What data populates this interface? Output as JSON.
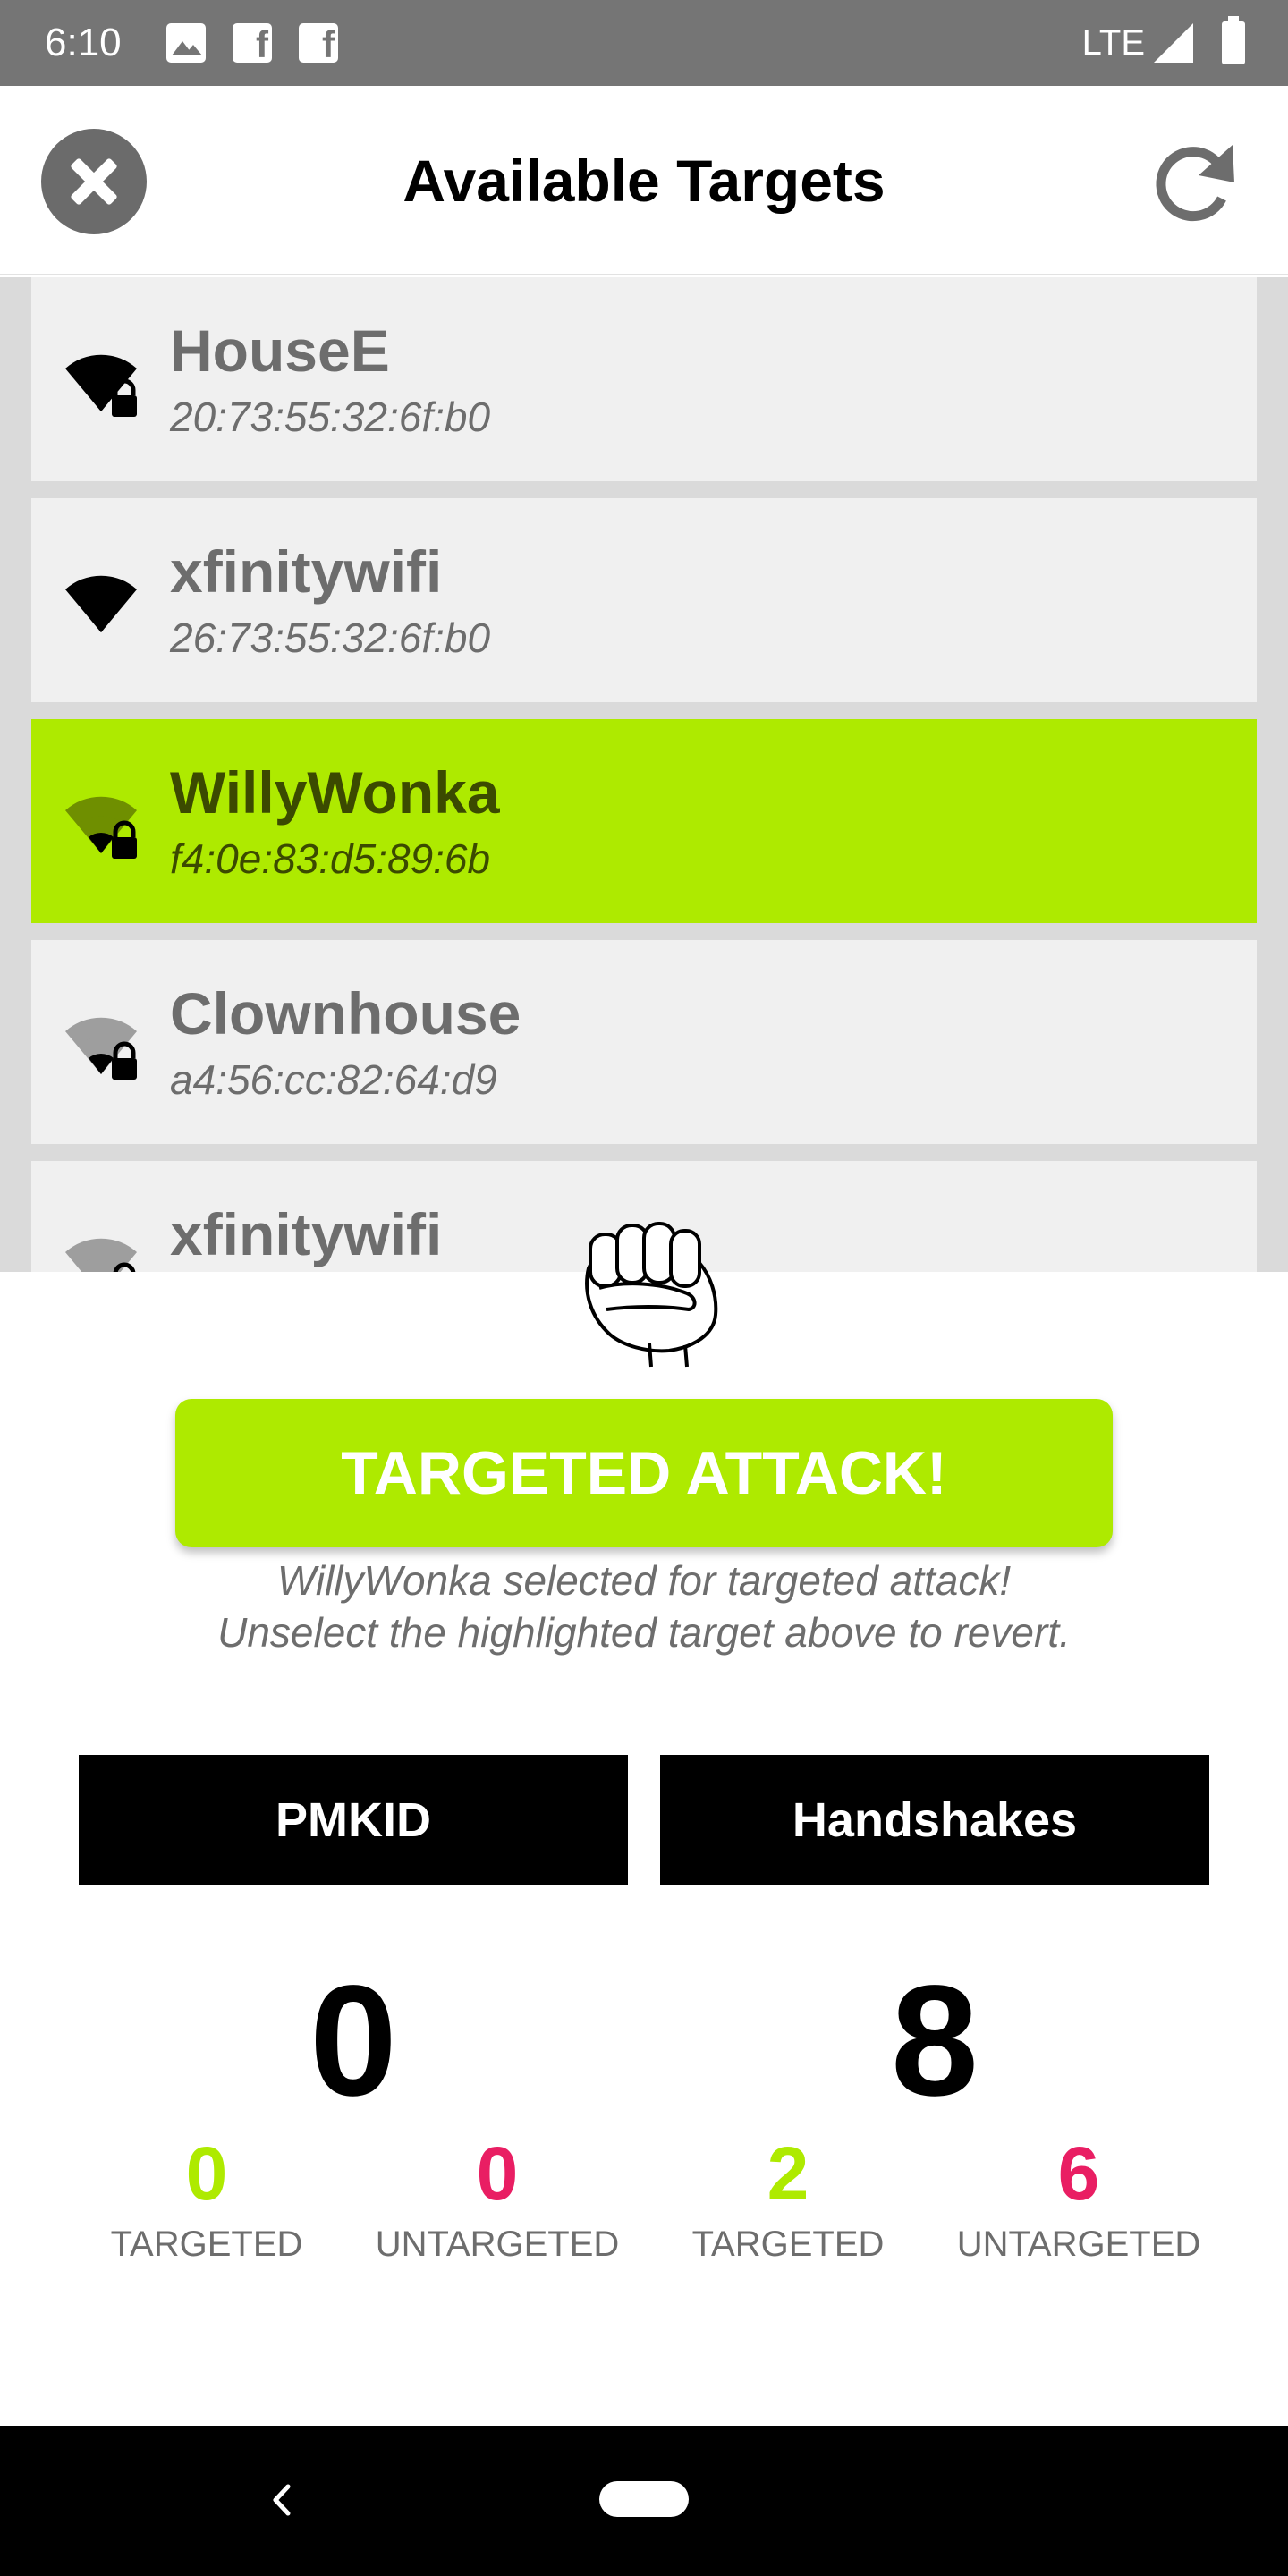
{
  "status_bar": {
    "time": "6:10",
    "network": "LTE",
    "notification_icons": [
      "image-icon",
      "facebook-icon",
      "facebook-icon"
    ]
  },
  "header": {
    "title": "Available Targets"
  },
  "targets": [
    {
      "name": "HouseE",
      "mac": "20:73:55:32:6f:b0",
      "signal": "full",
      "locked": true,
      "selected": false
    },
    {
      "name": "xfinitywifi",
      "mac": "26:73:55:32:6f:b0",
      "signal": "full",
      "locked": false,
      "selected": false
    },
    {
      "name": "WillyWonka",
      "mac": "f4:0e:83:d5:89:6b",
      "signal": "medium",
      "locked": true,
      "selected": true
    },
    {
      "name": "Clownhouse",
      "mac": "a4:56:cc:82:64:d9",
      "signal": "low",
      "locked": true,
      "selected": false
    },
    {
      "name": "xfinitywifi",
      "mac": "",
      "signal": "low",
      "locked": true,
      "selected": false
    }
  ],
  "attack": {
    "button_label": "TARGETED ATTACK!",
    "note_line1": "WillyWonka selected for targeted attack!",
    "note_line2": "Unselect the highlighted target above to revert."
  },
  "stats": {
    "pmkid": {
      "label": "PMKID",
      "total": "0",
      "targeted": "0",
      "untargeted": "0"
    },
    "handshakes": {
      "label": "Handshakes",
      "total": "8",
      "targeted": "2",
      "untargeted": "6"
    },
    "targeted_label": "TARGETED",
    "untargeted_label": "UNTARGETED"
  },
  "colors": {
    "accent_green": "#aeea00",
    "pink": "#e91e63",
    "status_bar": "#757575",
    "row_bg": "#f0f0f0"
  }
}
